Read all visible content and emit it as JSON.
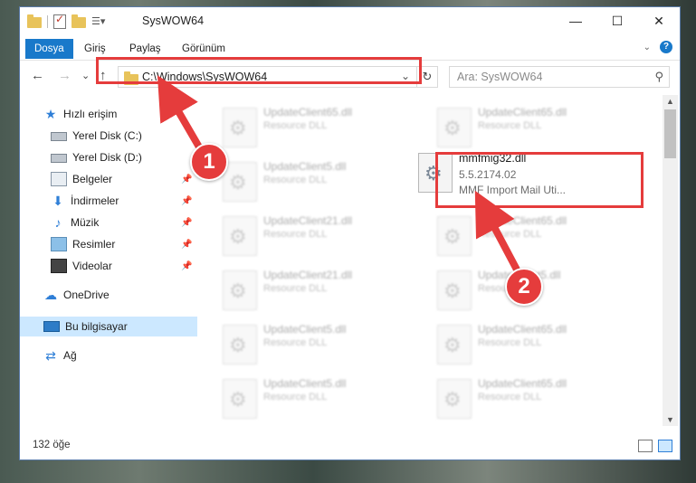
{
  "window": {
    "title": "SysWOW64",
    "controls": [
      "—",
      "☐",
      "✕"
    ]
  },
  "ribbon": {
    "tabs": [
      "Dosya",
      "Giriş",
      "Paylaş",
      "Görünüm"
    ],
    "help": "?"
  },
  "navigation": {
    "back": "←",
    "forward": "→",
    "recent": "⌄",
    "up": "↑",
    "address": "C:\\Windows\\SysWOW64",
    "address_chevron": "⌄",
    "refresh": "↻",
    "search_placeholder": "Ara: SysWOW64",
    "search_icon": "⚲"
  },
  "sidebar": {
    "items": [
      {
        "label": "Hızlı erişim",
        "icon": "star-icon"
      },
      {
        "label": "Yerel Disk (C:)",
        "icon": "drive-icon"
      },
      {
        "label": "Yerel Disk (D:)",
        "icon": "drive-icon"
      },
      {
        "label": "Belgeler",
        "icon": "documents-icon"
      },
      {
        "label": "İndirmeler",
        "icon": "downloads-icon"
      },
      {
        "label": "Müzik",
        "icon": "music-icon"
      },
      {
        "label": "Resimler",
        "icon": "pictures-icon"
      },
      {
        "label": "Videolar",
        "icon": "videos-icon"
      },
      {
        "label": "OneDrive",
        "icon": "cloud-icon"
      },
      {
        "label": "Bu bilgisayar",
        "icon": "computer-icon"
      },
      {
        "label": "Ağ",
        "icon": "network-icon"
      }
    ],
    "pin_glyph": "📌"
  },
  "files": {
    "left_column": [
      {
        "name": "UpdateClient65.dll",
        "desc": "Resource DLL"
      },
      {
        "name": "UpdateClient5.dll",
        "desc": "Resource DLL"
      },
      {
        "name": "UpdateClient21.dll",
        "desc": "Resource DLL"
      },
      {
        "name": "UpdateClient21.dll",
        "desc": "Resource DLL"
      },
      {
        "name": "UpdateClient5.dll",
        "desc": "Resource DLL"
      },
      {
        "name": "UpdateClient5.dll",
        "desc": "Resource DLL"
      }
    ],
    "right_column": [
      {
        "name": "UpdateClient65.dll",
        "desc": "Resource DLL"
      },
      {
        "name": "UpdateClient65.dll",
        "desc": "Resource DLL"
      },
      {
        "name": "UpdateClient5.dll",
        "desc": "Resource DLL"
      },
      {
        "name": "UpdateClient65.dll",
        "desc": "Resource DLL"
      },
      {
        "name": "UpdateClient65.dll",
        "desc": "Resource DLL"
      }
    ],
    "highlighted": {
      "name": "mmfmig32.dll",
      "version": "5.5.2174.02",
      "description": "MMF Import Mail Uti..."
    }
  },
  "status": {
    "item_count": "132 öğe"
  },
  "annotations": {
    "step1": "1",
    "step2": "2",
    "highlight_color": "#e53c3c"
  }
}
